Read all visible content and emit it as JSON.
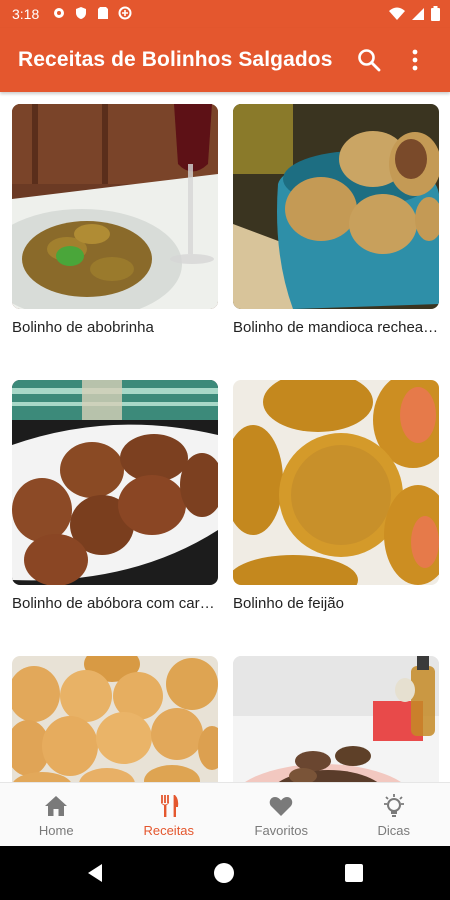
{
  "status": {
    "time": "3:18"
  },
  "app": {
    "title": "Receitas de Bolinhos Salgados"
  },
  "recipes": [
    {
      "title": "Bolinho de abobrinha"
    },
    {
      "title": "Bolinho de mandioca recheado"
    },
    {
      "title": "Bolinho de abóbora com carne seca"
    },
    {
      "title": "Bolinho de feijão"
    },
    {
      "title": ""
    },
    {
      "title": ""
    }
  ],
  "nav": [
    {
      "label": "Home",
      "icon": "home-icon"
    },
    {
      "label": "Receitas",
      "icon": "fork-knife-icon"
    },
    {
      "label": "Favoritos",
      "icon": "heart-icon"
    },
    {
      "label": "Dicas",
      "icon": "lightbulb-icon"
    }
  ],
  "colors": {
    "primary": "#e4572e",
    "active_nav": "#e4572e",
    "inactive_nav": "#7a7a7a"
  }
}
